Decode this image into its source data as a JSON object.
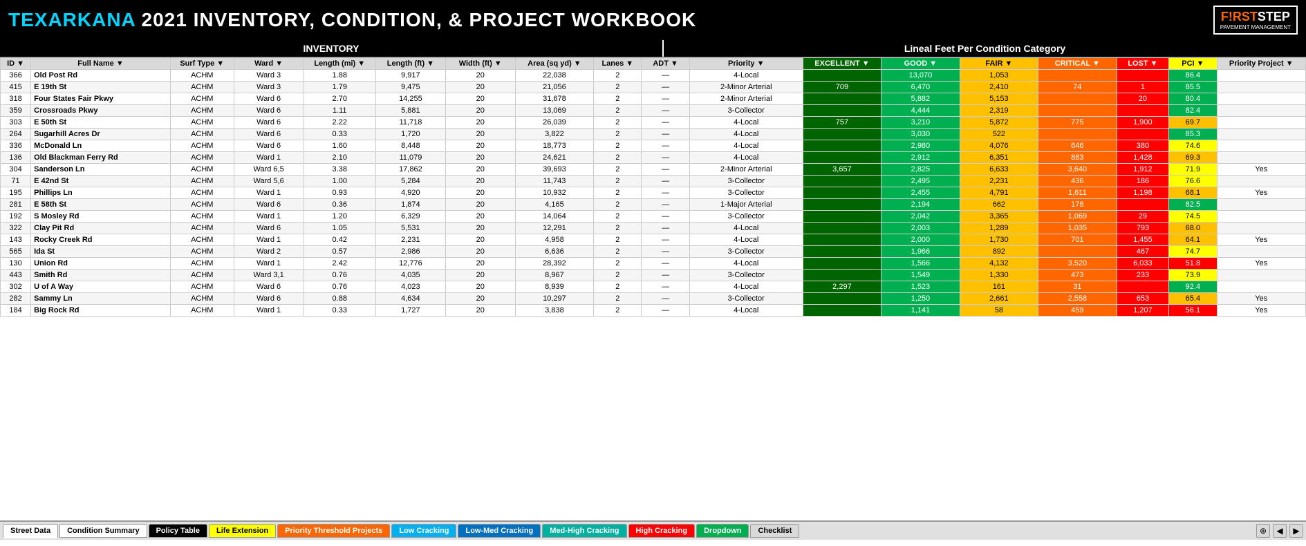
{
  "header": {
    "title_highlight": "TEXARKANA",
    "title_rest": " 2021 INVENTORY, CONDITION, & PROJECT WORKBOOK",
    "logo_first": "F!RST",
    "logo_second": "STEP",
    "logo_sub": "PAVEMENT MANAGEMENT"
  },
  "section_inv": "INVENTORY",
  "section_cond": "Lineal Feet Per Condition Category",
  "columns": {
    "id": "ID",
    "name": "Full Name",
    "surf": "Surf Type",
    "ward": "Ward",
    "lmi": "Length (mi)",
    "lft": "Length (ft)",
    "wid": "Width (ft)",
    "area": "Area (sq yd)",
    "lanes": "Lanes",
    "adt": "ADT",
    "priority": "Priority",
    "exc": "EXCELLENT",
    "good": "GOOD",
    "fair": "FAIR",
    "critical": "CRITICAL",
    "lost": "LOST",
    "pci": "PCI",
    "proj": "Priority Project"
  },
  "rows": [
    {
      "id": 366,
      "name": "Old Post Rd",
      "surf": "ACHM",
      "ward": "Ward 3",
      "lmi": "1.88",
      "lft": "9,917",
      "wid": "20",
      "area": "22,038",
      "lanes": "2",
      "adt": "—",
      "priority": "4-Local",
      "exc": "",
      "good": "13,070",
      "fair": "1,053",
      "critical": "",
      "lost": "",
      "pci": "86.4",
      "proj": "",
      "pci_class": "high"
    },
    {
      "id": 415,
      "name": "E 19th St",
      "surf": "ACHM",
      "ward": "Ward 3",
      "lmi": "1.79",
      "lft": "9,475",
      "wid": "20",
      "area": "21,056",
      "lanes": "2",
      "adt": "—",
      "priority": "2-Minor Arterial",
      "exc": "709",
      "good": "6,470",
      "fair": "2,410",
      "critical": "74",
      "lost": "1",
      "pci": "85.5",
      "proj": "",
      "pci_class": "high"
    },
    {
      "id": 318,
      "name": "Four States Fair Pkwy",
      "surf": "ACHM",
      "ward": "Ward 6",
      "lmi": "2.70",
      "lft": "14,255",
      "wid": "20",
      "area": "31,678",
      "lanes": "2",
      "adt": "—",
      "priority": "2-Minor Arterial",
      "exc": "",
      "good": "5,882",
      "fair": "5,153",
      "critical": "",
      "lost": "20",
      "pci": "80.4",
      "proj": "",
      "pci_class": "high"
    },
    {
      "id": 359,
      "name": "Crossroads Pkwy",
      "surf": "ACHM",
      "ward": "Ward 6",
      "lmi": "1.11",
      "lft": "5,881",
      "wid": "20",
      "area": "13,069",
      "lanes": "2",
      "adt": "—",
      "priority": "3-Collector",
      "exc": "",
      "good": "4,444",
      "fair": "2,319",
      "critical": "",
      "lost": "",
      "pci": "82.4",
      "proj": "",
      "pci_class": "high"
    },
    {
      "id": 303,
      "name": "E 50th St",
      "surf": "ACHM",
      "ward": "Ward 6",
      "lmi": "2.22",
      "lft": "11,718",
      "wid": "20",
      "area": "26,039",
      "lanes": "2",
      "adt": "—",
      "priority": "4-Local",
      "exc": "757",
      "good": "3,210",
      "fair": "5,872",
      "critical": "775",
      "lost": "1,900",
      "pci": "69.7",
      "proj": "",
      "pci_class": "med"
    },
    {
      "id": 264,
      "name": "Sugarhill Acres Dr",
      "surf": "ACHM",
      "ward": "Ward 6",
      "lmi": "0.33",
      "lft": "1,720",
      "wid": "20",
      "area": "3,822",
      "lanes": "2",
      "adt": "—",
      "priority": "4-Local",
      "exc": "",
      "good": "3,030",
      "fair": "522",
      "critical": "",
      "lost": "",
      "pci": "85.3",
      "proj": "",
      "pci_class": "high"
    },
    {
      "id": 336,
      "name": "McDonald Ln",
      "surf": "ACHM",
      "ward": "Ward 6",
      "lmi": "1.60",
      "lft": "8,448",
      "wid": "20",
      "area": "18,773",
      "lanes": "2",
      "adt": "—",
      "priority": "4-Local",
      "exc": "",
      "good": "2,980",
      "fair": "4,076",
      "critical": "646",
      "lost": "380",
      "pci": "74.6",
      "proj": "",
      "pci_class": "med"
    },
    {
      "id": 136,
      "name": "Old Blackman Ferry Rd",
      "surf": "ACHM",
      "ward": "Ward 1",
      "lmi": "2.10",
      "lft": "11,079",
      "wid": "20",
      "area": "24,621",
      "lanes": "2",
      "adt": "—",
      "priority": "4-Local",
      "exc": "",
      "good": "2,912",
      "fair": "6,351",
      "critical": "883",
      "lost": "1,428",
      "pci": "69.3",
      "proj": "",
      "pci_class": "med"
    },
    {
      "id": 304,
      "name": "Sanderson Ln",
      "surf": "ACHM",
      "ward": "Ward 6,5",
      "lmi": "3.38",
      "lft": "17,862",
      "wid": "20",
      "area": "39,693",
      "lanes": "2",
      "adt": "—",
      "priority": "2-Minor Arterial",
      "exc": "3,657",
      "good": "2,825",
      "fair": "6,633",
      "critical": "3,640",
      "lost": "1,912",
      "pci": "71.9",
      "proj": "Yes",
      "pci_class": "med"
    },
    {
      "id": 71,
      "name": "E 42nd St",
      "surf": "ACHM",
      "ward": "Ward 5,6",
      "lmi": "1.00",
      "lft": "5,284",
      "wid": "20",
      "area": "11,743",
      "lanes": "2",
      "adt": "—",
      "priority": "3-Collector",
      "exc": "",
      "good": "2,495",
      "fair": "2,231",
      "critical": "436",
      "lost": "186",
      "pci": "76.6",
      "proj": "",
      "pci_class": "med"
    },
    {
      "id": 195,
      "name": "Phillips Ln",
      "surf": "ACHM",
      "ward": "Ward 1",
      "lmi": "0.93",
      "lft": "4,920",
      "wid": "20",
      "area": "10,932",
      "lanes": "2",
      "adt": "—",
      "priority": "3-Collector",
      "exc": "",
      "good": "2,455",
      "fair": "4,791",
      "critical": "1,611",
      "lost": "1,198",
      "pci": "68.1",
      "proj": "Yes",
      "pci_class": "med"
    },
    {
      "id": 281,
      "name": "E 58th St",
      "surf": "ACHM",
      "ward": "Ward 6",
      "lmi": "0.36",
      "lft": "1,874",
      "wid": "20",
      "area": "4,165",
      "lanes": "2",
      "adt": "—",
      "priority": "1-Major Arterial",
      "exc": "",
      "good": "2,194",
      "fair": "662",
      "critical": "178",
      "lost": "",
      "pci": "82.5",
      "proj": "",
      "pci_class": "high"
    },
    {
      "id": 192,
      "name": "S Mosley Rd",
      "surf": "ACHM",
      "ward": "Ward 1",
      "lmi": "1.20",
      "lft": "6,329",
      "wid": "20",
      "area": "14,064",
      "lanes": "2",
      "adt": "—",
      "priority": "3-Collector",
      "exc": "",
      "good": "2,042",
      "fair": "3,365",
      "critical": "1,069",
      "lost": "29",
      "pci": "74.5",
      "proj": "",
      "pci_class": "med"
    },
    {
      "id": 322,
      "name": "Clay Pit Rd",
      "surf": "ACHM",
      "ward": "Ward 6",
      "lmi": "1.05",
      "lft": "5,531",
      "wid": "20",
      "area": "12,291",
      "lanes": "2",
      "adt": "—",
      "priority": "4-Local",
      "exc": "",
      "good": "2,003",
      "fair": "1,289",
      "critical": "1,035",
      "lost": "793",
      "pci": "68.0",
      "proj": "",
      "pci_class": "med"
    },
    {
      "id": 143,
      "name": "Rocky Creek Rd",
      "surf": "ACHM",
      "ward": "Ward 1",
      "lmi": "0.42",
      "lft": "2,231",
      "wid": "20",
      "area": "4,958",
      "lanes": "2",
      "adt": "—",
      "priority": "4-Local",
      "exc": "",
      "good": "2,000",
      "fair": "1,730",
      "critical": "701",
      "lost": "1,455",
      "pci": "64.1",
      "proj": "Yes",
      "pci_class": "med"
    },
    {
      "id": 565,
      "name": "Ida St",
      "surf": "ACHM",
      "ward": "Ward 2",
      "lmi": "0.57",
      "lft": "2,986",
      "wid": "20",
      "area": "6,636",
      "lanes": "2",
      "adt": "—",
      "priority": "3-Collector",
      "exc": "",
      "good": "1,966",
      "fair": "892",
      "critical": "",
      "lost": "467",
      "pci": "74.7",
      "proj": "",
      "pci_class": "med"
    },
    {
      "id": 130,
      "name": "Union Rd",
      "surf": "ACHM",
      "ward": "Ward 1",
      "lmi": "2.42",
      "lft": "12,776",
      "wid": "20",
      "area": "28,392",
      "lanes": "2",
      "adt": "—",
      "priority": "4-Local",
      "exc": "",
      "good": "1,566",
      "fair": "4,132",
      "critical": "3,520",
      "lost": "6,033",
      "pci": "51.8",
      "proj": "Yes",
      "pci_class": "low"
    },
    {
      "id": 443,
      "name": "Smith Rd",
      "surf": "ACHM",
      "ward": "Ward 3,1",
      "lmi": "0.76",
      "lft": "4,035",
      "wid": "20",
      "area": "8,967",
      "lanes": "2",
      "adt": "—",
      "priority": "3-Collector",
      "exc": "",
      "good": "1,549",
      "fair": "1,330",
      "critical": "473",
      "lost": "233",
      "pci": "73.9",
      "proj": "",
      "pci_class": "med"
    },
    {
      "id": 302,
      "name": "U of A Way",
      "surf": "ACHM",
      "ward": "Ward 6",
      "lmi": "0.76",
      "lft": "4,023",
      "wid": "20",
      "area": "8,939",
      "lanes": "2",
      "adt": "—",
      "priority": "4-Local",
      "exc": "2,297",
      "good": "1,523",
      "fair": "161",
      "critical": "31",
      "lost": "",
      "pci": "92.4",
      "proj": "",
      "pci_class": "high"
    },
    {
      "id": 282,
      "name": "Sammy Ln",
      "surf": "ACHM",
      "ward": "Ward 6",
      "lmi": "0.88",
      "lft": "4,634",
      "wid": "20",
      "area": "10,297",
      "lanes": "2",
      "adt": "—",
      "priority": "3-Collector",
      "exc": "",
      "good": "1,250",
      "fair": "2,661",
      "critical": "2,558",
      "lost": "653",
      "pci": "65.4",
      "proj": "Yes",
      "pci_class": "med"
    },
    {
      "id": 184,
      "name": "Big Rock Rd",
      "surf": "ACHM",
      "ward": "Ward 1",
      "lmi": "0.33",
      "lft": "1,727",
      "wid": "20",
      "area": "3,838",
      "lanes": "2",
      "adt": "—",
      "priority": "4-Local",
      "exc": "",
      "good": "1,141",
      "fair": "58",
      "critical": "459",
      "lost": "1,207",
      "pci": "56.1",
      "proj": "Yes",
      "pci_class": "low"
    }
  ],
  "tabs": [
    {
      "label": "Street Data",
      "class": "tab-active tab-white"
    },
    {
      "label": "Condition Summary",
      "class": "tab-white"
    },
    {
      "label": "Policy Table",
      "class": "tab-black"
    },
    {
      "label": "Life Extension",
      "class": "tab-yellow"
    },
    {
      "label": "Priority Threshold Projects",
      "class": "tab-orange"
    },
    {
      "label": "Low Cracking",
      "class": "tab-blue"
    },
    {
      "label": "Low-Med Cracking",
      "class": "tab-lblue"
    },
    {
      "label": "Med-High Cracking",
      "class": "tab-cyan"
    },
    {
      "label": "High Cracking",
      "class": "tab-red"
    },
    {
      "label": "Dropdown",
      "class": "tab-green"
    },
    {
      "label": "Checklist",
      "class": "tab-gray"
    }
  ]
}
